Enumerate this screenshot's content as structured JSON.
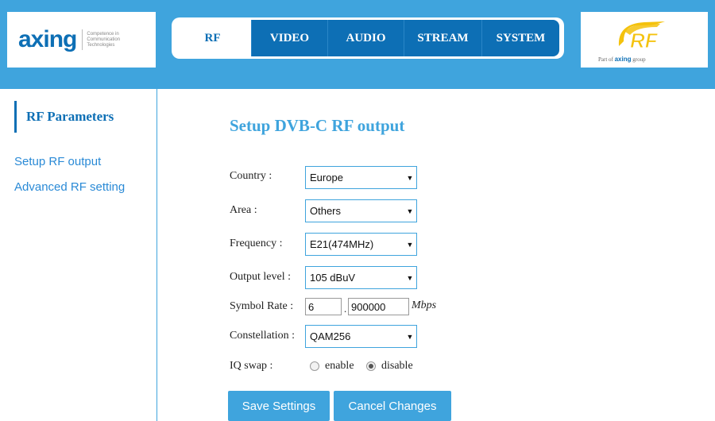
{
  "brand": {
    "axing_name": "axing",
    "axing_tagline": [
      "Competence in",
      "Communication",
      "Technologies"
    ],
    "rf_logo_text": "RF",
    "part_of_prefix": "Part of",
    "part_of_brand": "axing",
    "part_of_suffix": "group"
  },
  "nav": {
    "tabs": [
      {
        "label": "RF",
        "active": true
      },
      {
        "label": "VIDEO",
        "active": false
      },
      {
        "label": "AUDIO",
        "active": false
      },
      {
        "label": "STREAM",
        "active": false
      },
      {
        "label": "SYSTEM",
        "active": false
      }
    ]
  },
  "sidebar": {
    "title": "RF Parameters",
    "links": [
      {
        "label": "Setup RF output"
      },
      {
        "label": "Advanced RF setting"
      }
    ]
  },
  "main": {
    "title": "Setup DVB-C RF output",
    "fields": {
      "country": {
        "label": "Country :",
        "value": "Europe"
      },
      "area": {
        "label": "Area :",
        "value": "Others"
      },
      "frequency": {
        "label": "Frequency :",
        "value": "E21(474MHz)"
      },
      "output_level": {
        "label": "Output level :",
        "value": "105 dBuV"
      },
      "symbol_rate": {
        "label": "Symbol Rate :",
        "integer": "6",
        "separator": ".",
        "fraction": "900000",
        "unit": "Mbps"
      },
      "constellation": {
        "label": "Constellation :",
        "value": "QAM256"
      },
      "iq_swap": {
        "label": "IQ swap :",
        "options": [
          "enable",
          "disable"
        ],
        "selected": "disable"
      }
    },
    "buttons": {
      "save": "Save Settings",
      "cancel": "Cancel Changes"
    }
  },
  "colors": {
    "header_blue": "#3fa4dd",
    "dark_blue": "#0d6fb5",
    "rf_logo_yellow": "#f4c20d"
  },
  "icons": {
    "dropdown": "chevron-down-icon",
    "radio": "radio-button"
  }
}
